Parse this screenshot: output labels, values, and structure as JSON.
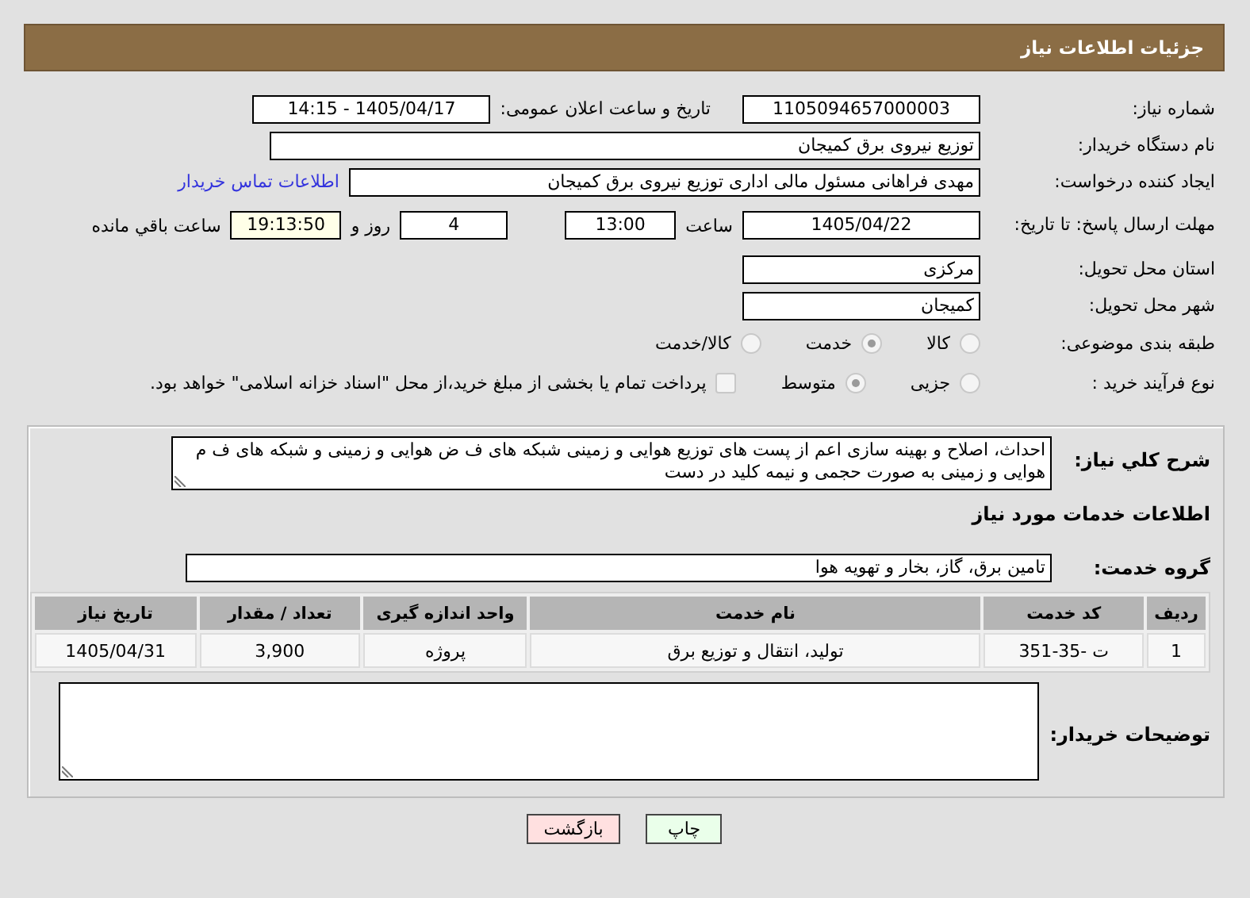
{
  "header": {
    "title": "جزئیات اطلاعات نیاز"
  },
  "need_number": {
    "label": "شماره نیاز:",
    "value": "1105094657000003"
  },
  "announce": {
    "label": "تاریخ و ساعت اعلان عمومی:",
    "value": "1405/04/17 - 14:15"
  },
  "buyer": {
    "label": "نام دستگاه خریدار:",
    "value": "توزیع نیروی برق کمیجان"
  },
  "creator": {
    "label": "ایجاد کننده درخواست:",
    "value": "مهدی فراهانی مسئول مالی اداری توزیع نیروی برق کمیجان",
    "link": "اطلاعات تماس خریدار"
  },
  "deadline": {
    "label": "مهلت ارسال پاسخ: تا تاریخ:",
    "date": "1405/04/22",
    "time_label": "ساعت",
    "time": "13:00",
    "days": "4",
    "days_label": "روز و",
    "remaining": "19:13:50",
    "remaining_label": "ساعت باقي مانده"
  },
  "province": {
    "label": "استان محل تحویل:",
    "value": "مرکزی"
  },
  "city": {
    "label": "شهر محل تحویل:",
    "value": "کمیجان"
  },
  "category": {
    "label": "طبقه بندی موضوعی:",
    "options": [
      {
        "label": "کالا",
        "selected": false
      },
      {
        "label": "خدمت",
        "selected": true
      },
      {
        "label": "کالا/خدمت",
        "selected": false
      }
    ]
  },
  "process": {
    "label": "نوع فرآیند خرید :",
    "options": [
      {
        "label": "جزیی",
        "selected": false
      },
      {
        "label": "متوسط",
        "selected": true
      }
    ],
    "treasury": {
      "checked": false,
      "text": "پرداخت تمام یا بخشی از مبلغ خرید،از محل \"اسناد خزانه اسلامی\" خواهد بود."
    }
  },
  "description": {
    "label": "شرح کلي نیاز:",
    "value": "احداث، اصلاح و بهینه سازی اعم از پست های توزیع هوایی و زمینی شبکه های ف ض هوایی و زمینی و شبکه های ف م هوایی و زمینی به صورت حجمی و نیمه کلید در دست"
  },
  "services_heading": "اطلاعات خدمات مورد نیاز",
  "service_group": {
    "label": "گروه خدمت:",
    "value": "تامین برق، گاز، بخار و تهویه هوا"
  },
  "table": {
    "columns": [
      "ردیف",
      "کد خدمت",
      "نام خدمت",
      "واحد اندازه گیری",
      "تعداد / مقدار",
      "تاریخ نیاز"
    ],
    "rows": [
      [
        "1",
        "ت -35-351",
        "تولید، انتقال و توزیع برق",
        "پروژه",
        "3,900",
        "1405/04/31"
      ]
    ]
  },
  "notes": {
    "label": "توضیحات خریدار:"
  },
  "buttons": [
    {
      "label": "چاپ",
      "kind": "print"
    },
    {
      "label": "بازگشت",
      "kind": "back"
    }
  ]
}
